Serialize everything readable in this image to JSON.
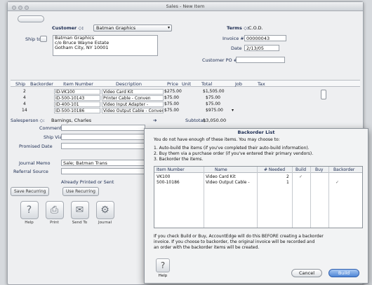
{
  "window": {
    "title": "Sales - New Item"
  },
  "header": {
    "customer_label": "Customer ◇:",
    "customer_value": "Batman Graphics",
    "terms_label": "Terms ◇:",
    "terms_value": "C.O.D.",
    "ship_to_label": "Ship to",
    "ship_to_lines": [
      "Batman Graphics",
      "c/o Bruce Wayne Estate",
      "Gotham City, NY 10001"
    ],
    "invoice_label": "Invoice #",
    "invoice_value": "00000043",
    "date_label": "Date",
    "date_value": "2/13/05",
    "po_label": "Customer PO #"
  },
  "lines": {
    "columns": [
      "Ship",
      "Backorder",
      "Item Number",
      "Description",
      "Price",
      "Unit",
      "Total",
      "Job",
      "Tax"
    ],
    "rows": [
      {
        "ship": "2",
        "item": "ID-VK100",
        "desc": "Video Card Kit",
        "price": "$275.00",
        "total": "$1,505.00"
      },
      {
        "ship": "4",
        "item": "ID-500-10143",
        "desc": "Printer Cable - Conven",
        "price": "$75.00",
        "total": "$75.00"
      },
      {
        "ship": "4",
        "item": "ID-400-101",
        "desc": "Video Input Adapter -",
        "price": "$75.00",
        "total": "$75.00"
      },
      {
        "ship": "14",
        "item": "ID-500-10186",
        "desc": "Video Output Cable - Conven",
        "price": "$75.00",
        "total": "$975.00"
      }
    ]
  },
  "footer": {
    "salesperson_label": "Salesperson ◇:",
    "salesperson_value": "Barnings, Charles",
    "comment_label": "Comment",
    "shipvia_label": "Ship Via",
    "promised_label": "Promised Date",
    "subtotal_label": "Subtotal:",
    "subtotal_value": "$3,050.00",
    "journal_label": "Journal Memo",
    "journal_value": "Sale; Batman Trans",
    "referral_label": "Referral Source",
    "printed_label": "Already Printed or Sent"
  },
  "toolbar": {
    "buttons": [
      "Save Recurring",
      "Use Recurring"
    ],
    "icons": [
      "Help",
      "Print",
      "Send To",
      "Journal"
    ]
  },
  "sheet": {
    "title": "Backorder List",
    "intro": "You do not have enough of these items.  You may choose to:",
    "options": [
      "1.  Auto-build the items (if you've completed their auto-build information).",
      "2.  Buy them via a purchase order (if you've entered their primary vendors).",
      "3.  Backorder the items."
    ],
    "columns": [
      "Item Number",
      "Name",
      "# Needed",
      "Build",
      "Buy",
      "Backorder"
    ],
    "rows": [
      {
        "item": "VK100",
        "name": "Video Card Kit",
        "needed": "2"
      },
      {
        "item": "500-10186",
        "name": "Video Output Cable -",
        "needed": "1"
      }
    ],
    "note": [
      "If you check Build or Buy, AccountEdge will do this BEFORE creating a backorder",
      "invoice.  If you choose to backorder, the original invoice will be recorded and",
      "an order with the backorder items will be created."
    ],
    "help_label": "Help",
    "cancel_label": "Cancel",
    "ok_label": "Build"
  }
}
